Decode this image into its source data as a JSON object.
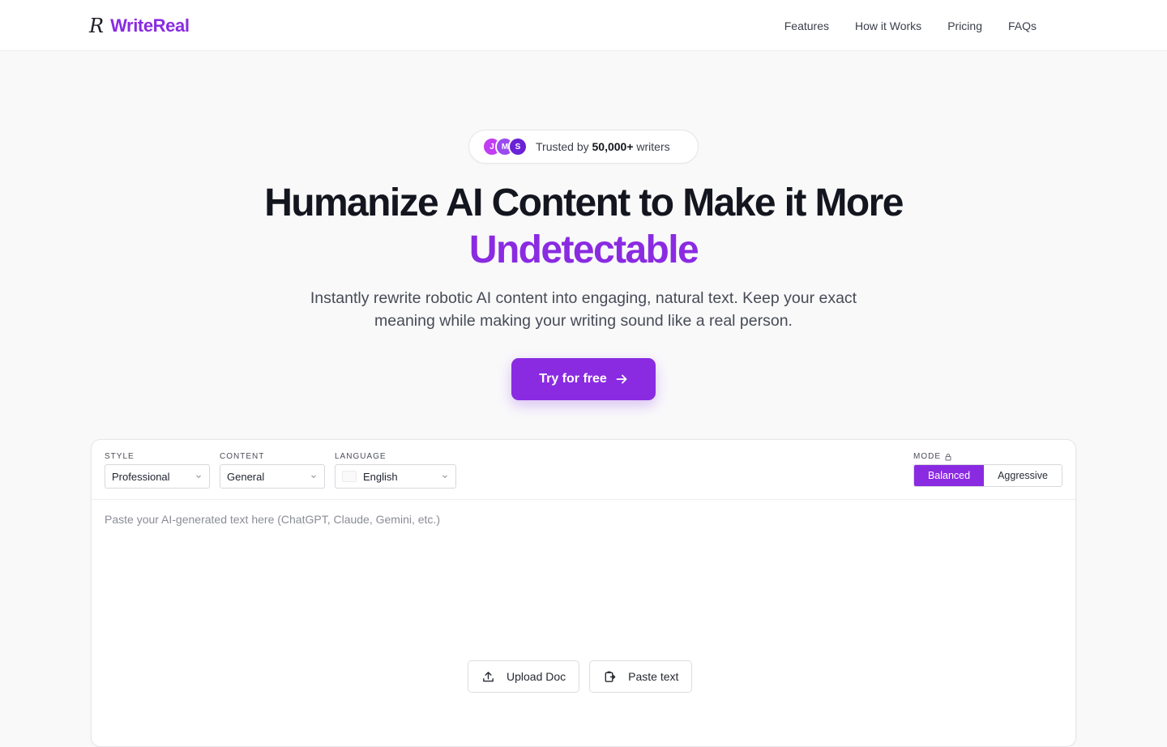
{
  "brand": {
    "mark": "R",
    "name": "WriteReal",
    "color": "#8a2be2"
  },
  "nav": [
    {
      "label": "Features"
    },
    {
      "label": "How it Works"
    },
    {
      "label": "Pricing"
    },
    {
      "label": "FAQs"
    }
  ],
  "trust": {
    "avatars": [
      {
        "initial": "J",
        "color": "#c13df2"
      },
      {
        "initial": "M",
        "color": "#9a4bf0"
      },
      {
        "initial": "S",
        "color": "#6a22d6"
      }
    ],
    "prefix": "Trusted by ",
    "count": "50,000+",
    "suffix": " writers"
  },
  "hero": {
    "title_line1": "Humanize AI Content to Make it More",
    "title_line2": "Undetectable",
    "subtitle": "Instantly rewrite robotic AI content into engaging, natural text. Keep your exact meaning while making your writing sound like a real person.",
    "cta_label": "Try for free",
    "cta_icon": "arrow-right-icon"
  },
  "editor": {
    "style": {
      "label": "STYLE",
      "value": "Professional"
    },
    "content": {
      "label": "CONTENT",
      "value": "General"
    },
    "language": {
      "label": "LANGUAGE",
      "value": "English"
    },
    "mode": {
      "label": "MODE",
      "icon": "lock-icon",
      "options": [
        "Balanced",
        "Aggressive"
      ],
      "selected": "Balanced"
    },
    "placeholder": "Paste your AI-generated text here (ChatGPT, Claude, Gemini, etc.)",
    "upload_label": "Upload Doc",
    "paste_label": "Paste text"
  }
}
